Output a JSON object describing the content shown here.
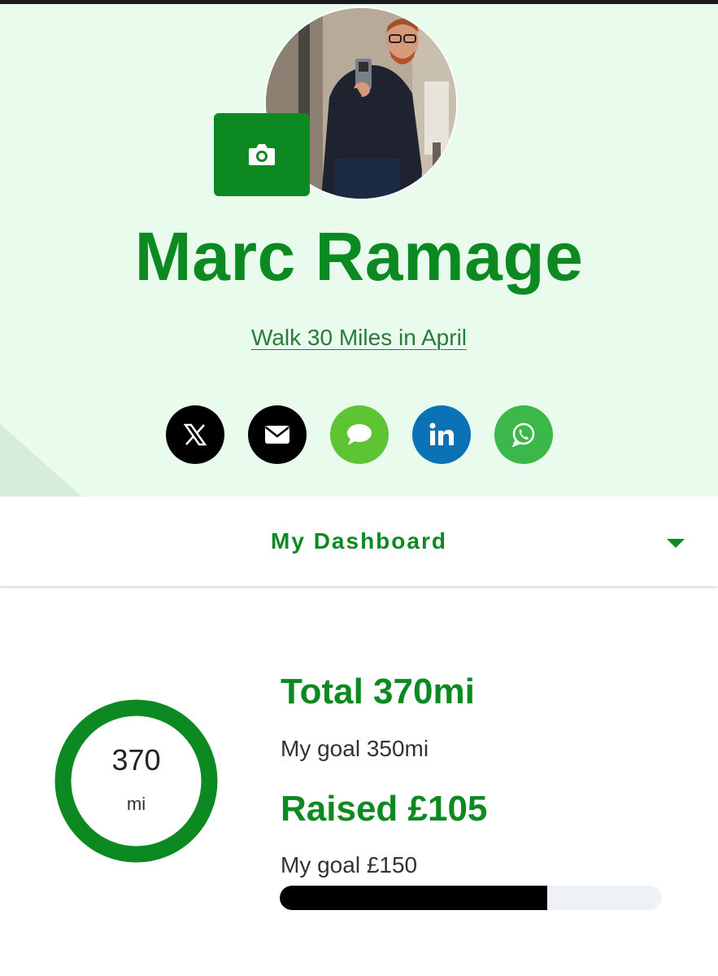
{
  "profile": {
    "name": "Marc Ramage",
    "event_link": "Walk 30 Miles in April",
    "avatar": "profile-photo",
    "camera_icon": "camera-icon"
  },
  "share": [
    {
      "name": "x",
      "icon": "x-logo-icon",
      "color": "#000000"
    },
    {
      "name": "email",
      "icon": "envelope-icon",
      "color": "#000000"
    },
    {
      "name": "sms",
      "icon": "chat-bubble-icon",
      "color": "#5ec434"
    },
    {
      "name": "linkedin",
      "icon": "linkedin-icon",
      "color": "#0a72b5"
    },
    {
      "name": "whatsapp",
      "icon": "whatsapp-icon",
      "color": "#3cb84a"
    }
  ],
  "dashboard": {
    "title": "My Dashboard",
    "toggle_icon": "caret-down-icon"
  },
  "stats": {
    "ring_value": "370",
    "ring_unit": "mi",
    "ring_progress": 1.0,
    "total": "Total 370mi",
    "distance_goal": "My goal 350mi",
    "raised": "Raised £105",
    "money_goal": "My goal £150",
    "money_progress": 0.7
  },
  "colors": {
    "brand_green": "#0c8a21",
    "hero_bg": "#e8fbec"
  }
}
